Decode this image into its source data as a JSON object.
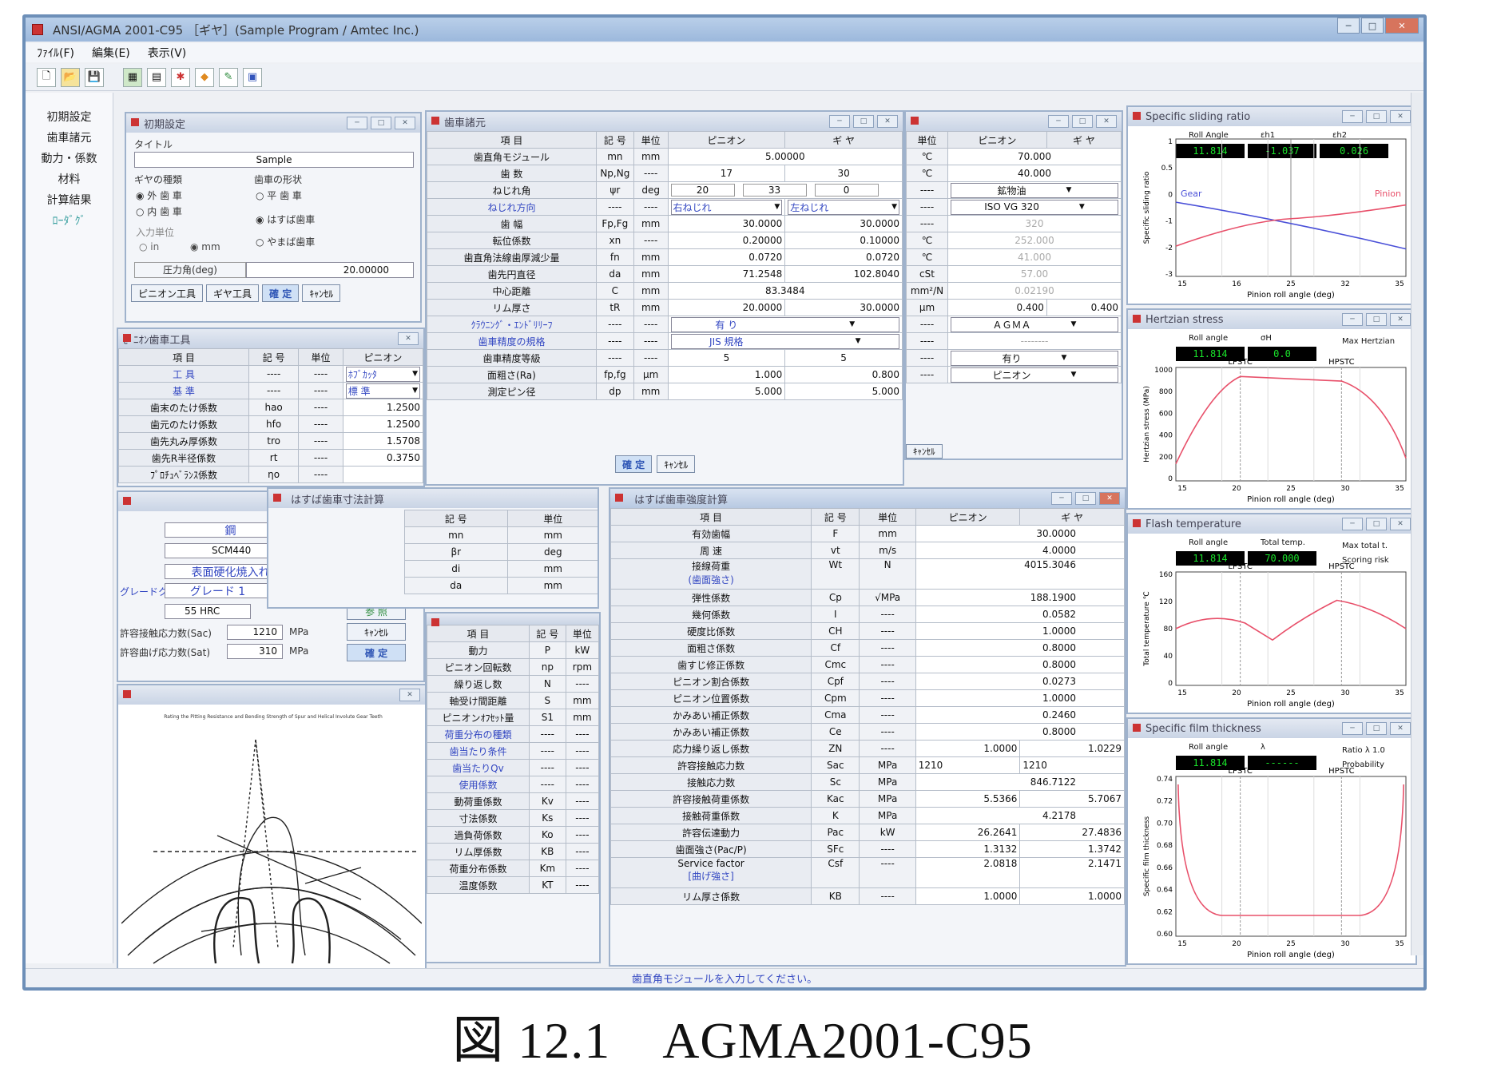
{
  "app": {
    "title": "ANSI/AGMA 2001-C95 ［ギヤ］(Sample Program / Amtec Inc.)",
    "menus": [
      "ﾌｧｲﾙ(F)",
      "編集(E)",
      "表示(V)"
    ],
    "nav": [
      "初期設定",
      "歯車諸元",
      "動力・係数",
      "材料",
      "計算結果",
      "ﾛｰﾀﾞｸﾞ"
    ],
    "status": "歯直角モジュールを入力してください。"
  },
  "initial": {
    "title": "初期設定",
    "title_label": "タイトル",
    "title_value": "Sample",
    "gear_kind_label": "ギヤの種類",
    "gear_kind_options": [
      "外 歯 車",
      "内 歯 車"
    ],
    "tooth_shape_label": "歯車の形状",
    "tooth_shape_options": [
      "平 歯 車",
      "はすば歯車",
      "やまば歯車"
    ],
    "unit_label": "入力単位",
    "unit_options": [
      "in",
      "mm"
    ],
    "pressure_angle_label": "圧力角(deg)",
    "pressure_angle_value": "20.00000",
    "buttons": [
      "ピニオン工具",
      "ギヤ工具",
      "確 定",
      "ｷｬﾝｾﾙ"
    ]
  },
  "cutter": {
    "title": "ﾋﾟﾆｵﾝ歯車工具",
    "headers": [
      "項 目",
      "記 号",
      "単位",
      "ピニオン"
    ],
    "rows": [
      [
        "工 具",
        "----",
        "----",
        "ﾎﾌﾞｶｯﾀ"
      ],
      [
        "基 準",
        "----",
        "----",
        "標 準"
      ],
      [
        "歯末のたけ係数",
        "hao",
        "----",
        "1.2500"
      ],
      [
        "歯元のたけ係数",
        "hfo",
        "----",
        "1.2500"
      ],
      [
        "歯先丸み厚係数",
        "tro",
        "----",
        "1.5708"
      ],
      [
        "歯先R半径係数",
        "rt",
        "----",
        "0.3750"
      ],
      [
        "ﾌﾟﾛﾁｭﾍﾞﾗﾝｽ係数",
        "ηo",
        "----",
        ""
      ]
    ]
  },
  "material": {
    "rows": [
      [
        "",
        "鋼"
      ],
      [
        "",
        "SCM440"
      ],
      [
        "",
        "表面硬化焼入れ"
      ],
      [
        "グレードクラス",
        "グレード 1"
      ],
      [
        "",
        "55 HRC"
      ],
      [
        "許容接触応力数(Sac)",
        "1210",
        "MPa"
      ],
      [
        "許容曲げ応力数(Sat)",
        "310",
        "MPa"
      ]
    ],
    "buttons": [
      "参 照",
      "ｷｬﾝｾﾙ",
      "確 定"
    ]
  },
  "figure": {
    "heading": "Rating the Pitting Resistance and Bending Strength of Spur and Helical Involute Gear Teeth"
  },
  "dims": {
    "title": "はすば歯車寸法計算",
    "headers": [
      "記 号",
      "単位"
    ],
    "rows": [
      [
        "mn",
        "mm"
      ],
      [
        "βr",
        "deg"
      ],
      [
        "di",
        "mm"
      ],
      [
        "da",
        "mm"
      ]
    ]
  },
  "power": {
    "headers": [
      "項 目",
      "記 号",
      "単位"
    ],
    "rows": [
      [
        "動力",
        "P",
        "kW"
      ],
      [
        "ピニオン回転数",
        "np",
        "rpm"
      ],
      [
        "繰り返し数",
        "N",
        "----"
      ],
      [
        "軸受け間距離",
        "S",
        "mm"
      ],
      [
        "ピニオンｵﾌｾｯﾄ量",
        "S1",
        "mm"
      ],
      [
        "荷重分布の種類",
        "----",
        "----"
      ],
      [
        "歯当たり条件",
        "----",
        "----"
      ],
      [
        "歯当たりQv",
        "----",
        "----"
      ],
      [
        "使用係数",
        "----",
        "----"
      ],
      [
        "動荷重係数",
        "Kv",
        "----"
      ],
      [
        "寸法係数",
        "Ks",
        "----"
      ],
      [
        "過負荷係数",
        "Ko",
        "----"
      ],
      [
        "リム厚係数",
        "KB",
        "----"
      ],
      [
        "荷重分布係数",
        "Km",
        "----"
      ],
      [
        "温度係数",
        "KT",
        "----"
      ]
    ]
  },
  "gear_spec": {
    "title": "歯車諸元",
    "headers": [
      "項 目",
      "記 号",
      "単位",
      "ピニオン",
      "ギ ヤ"
    ],
    "rows": [
      {
        "label": "歯直角モジュール",
        "sym": "mn",
        "unit": "mm",
        "p": "5.00000",
        "g": "",
        "merge": true
      },
      {
        "label": "歯 数",
        "sym": "Np,Ng",
        "unit": "----",
        "p": "17",
        "g": "30"
      },
      {
        "label": "ねじれ角",
        "sym": "ψr",
        "unit": "deg",
        "p": "20",
        "g": "",
        "helix": [
          "20",
          "33",
          "0"
        ]
      },
      {
        "label": "ねじれ方向",
        "sym": "----",
        "unit": "----",
        "p": "右ねじれ",
        "g": "左ねじれ",
        "blue": true,
        "dd": true
      },
      {
        "label": "歯 幅",
        "sym": "Fp,Fg",
        "unit": "mm",
        "p": "30.0000",
        "g": "30.0000"
      },
      {
        "label": "転位係数",
        "sym": "xn",
        "unit": "----",
        "p": "0.20000",
        "g": "0.10000"
      },
      {
        "label": "歯直角法線歯厚減少量",
        "sym": "fn",
        "unit": "mm",
        "p": "0.0720",
        "g": "0.0720"
      },
      {
        "label": "歯先円直径",
        "sym": "da",
        "unit": "mm",
        "p": "71.2548",
        "g": "102.8040"
      },
      {
        "label": "中心距離",
        "sym": "C",
        "unit": "mm",
        "p": "83.3484",
        "g": "",
        "merge": true
      },
      {
        "label": "リム厚さ",
        "sym": "tR",
        "unit": "mm",
        "p": "20.0000",
        "g": "30.0000"
      },
      {
        "label": "ｸﾗｳﾆﾝｸﾞ・ｴﾝﾄﾞﾘﾘｰﾌ",
        "sym": "----",
        "unit": "----",
        "p": "有 り",
        "g": "",
        "merge": true,
        "blue": true,
        "dd": true
      },
      {
        "label": "歯車精度の規格",
        "sym": "----",
        "unit": "----",
        "p": "JIS 規格",
        "g": "",
        "merge": true,
        "blue": true,
        "dd": true
      },
      {
        "label": "歯車精度等級",
        "sym": "----",
        "unit": "----",
        "p": "5",
        "g": "5"
      },
      {
        "label": "面粗さ(Ra)",
        "sym": "fp,fg",
        "unit": "μm",
        "p": "1.000",
        "g": "0.800"
      },
      {
        "label": "測定ピン径",
        "sym": "dp",
        "unit": "mm",
        "p": "5.000",
        "g": "5.000"
      }
    ],
    "buttons": [
      "確 定",
      "ｷｬﾝｾﾙ"
    ]
  },
  "operating": {
    "headers": [
      "単位",
      "ピニオン",
      "ギ ヤ"
    ],
    "rows": [
      {
        "unit": "℃",
        "val": "70.000"
      },
      {
        "unit": "℃",
        "val": "40.000"
      },
      {
        "unit": "----",
        "val": "鉱物油",
        "dd": true
      },
      {
        "unit": "----",
        "val": "ISO VG 320",
        "dd": true
      },
      {
        "unit": "----",
        "val": "320",
        "dim": true
      },
      {
        "unit": "℃",
        "val": "252.000",
        "dim": true
      },
      {
        "unit": "℃",
        "val": "41.000",
        "dim": true
      },
      {
        "unit": "cSt",
        "val": "57.00",
        "dim": true
      },
      {
        "unit": "mm²/N",
        "val": "0.02190",
        "dim": true
      },
      {
        "unit": "μm",
        "p": "0.400",
        "g": "0.400"
      },
      {
        "unit": "----",
        "val": "ＡＧＭＡ",
        "dd": true
      },
      {
        "unit": "----",
        "val": "--------",
        "dim": true
      },
      {
        "unit": "----",
        "val": "有り",
        "dd": true
      },
      {
        "unit": "----",
        "val": "ピニオン",
        "dd": true
      }
    ],
    "button": "ｷｬﾝｾﾙ"
  },
  "strength": {
    "title": "はすば歯車強度計算",
    "headers": [
      "項 目",
      "記 号",
      "単位",
      "ピニオン",
      "ギ ヤ"
    ],
    "rows": [
      {
        "label": "有効歯幅",
        "sym": "F",
        "unit": "mm",
        "p": "30.0000",
        "merge": true
      },
      {
        "label": "周 速",
        "sym": "vt",
        "unit": "m/s",
        "p": "4.0000",
        "merge": true
      },
      {
        "label": "接線荷重",
        "sub": "(歯面強さ)",
        "sym": "Wt",
        "unit": "N",
        "p": "4015.3046",
        "merge": true,
        "tall": true
      },
      {
        "label": "弾性係数",
        "sym": "Cp",
        "unit": "√MPa",
        "p": "188.1900",
        "merge": true
      },
      {
        "label": "幾何係数",
        "sym": "I",
        "unit": "----",
        "p": "0.0582",
        "merge": true
      },
      {
        "label": "硬度比係数",
        "sym": "CH",
        "unit": "----",
        "p": "1.0000",
        "merge": true
      },
      {
        "label": "面粗さ係数",
        "sym": "Cf",
        "unit": "----",
        "p": "0.8000",
        "merge": true
      },
      {
        "label": "歯すじ修正係数",
        "sym": "Cmc",
        "unit": "----",
        "p": "0.8000",
        "merge": true
      },
      {
        "label": "ピニオン割合係数",
        "sym": "Cpf",
        "unit": "----",
        "p": "0.0273",
        "merge": true
      },
      {
        "label": "ピニオン位置係数",
        "sym": "Cpm",
        "unit": "----",
        "p": "1.0000",
        "merge": true
      },
      {
        "label": "かみあい補正係数",
        "sym": "Cma",
        "unit": "----",
        "p": "0.2460",
        "merge": true
      },
      {
        "label": "かみあい補正係数",
        "sym": "Ce",
        "unit": "----",
        "p": "0.8000",
        "merge": true
      },
      {
        "label": "応力繰り返し係数",
        "sym": "ZN",
        "unit": "----",
        "p": "1.0000",
        "g": "1.0229"
      },
      {
        "label": "許容接触応力数",
        "sym": "Sac",
        "unit": "MPa",
        "p": "1210",
        "g": "1210"
      },
      {
        "label": "接触応力数",
        "sym": "Sc",
        "unit": "MPa",
        "p": "846.7122",
        "merge": true
      },
      {
        "label": "許容接触荷重係数",
        "sym": "Kac",
        "unit": "MPa",
        "p": "5.5366",
        "g": "5.7067"
      },
      {
        "label": "接触荷重係数",
        "sym": "K",
        "unit": "MPa",
        "p": "4.2178",
        "merge": true
      },
      {
        "label": "許容伝達動力",
        "sym": "Pac",
        "unit": "kW",
        "p": "26.2641",
        "g": "27.4836"
      },
      {
        "label": "歯面強さ(Pac/P)",
        "sym": "SFc",
        "unit": "----",
        "p": "1.3132",
        "g": "1.3742"
      },
      {
        "label": "Service factor",
        "sub": "[曲げ強さ]",
        "sym": "Csf",
        "unit": "----",
        "p": "2.0818",
        "g": "2.1471",
        "tall": true
      },
      {
        "label": "リム厚さ係数",
        "sym": "KB",
        "unit": "----",
        "p": "1.0000",
        "g": "1.0000"
      }
    ]
  },
  "charts": [
    {
      "title": "Specific sliding ratio",
      "readout_labels": [
        "Roll Angle",
        "εh1",
        "εh2"
      ],
      "readout_values": [
        "11.814",
        "-1.037",
        "0.026"
      ],
      "ylabel": "Specific sliding ratio",
      "xlabel": "Pinion roll angle (deg)",
      "legend": [
        "Gear",
        "Pinion"
      ],
      "yticks": [
        "1",
        "0.5",
        "0",
        "-1",
        "-2",
        "-3"
      ],
      "xticks": [
        "15",
        "16",
        "25",
        "32",
        "35"
      ]
    },
    {
      "title": "Hertzian stress",
      "readout_labels": [
        "Roll angle",
        "σH"
      ],
      "readout_values": [
        "11.814",
        "0.0"
      ],
      "side_label": "Max Hertzian",
      "ylabel": "Hertzian stress (MPa)",
      "xlabel": "Pinion roll angle (deg)",
      "markers": [
        "LPSTC",
        "HPSTC"
      ],
      "yticks": [
        "1000",
        "800",
        "600",
        "400",
        "200",
        "0"
      ],
      "xticks": [
        "15",
        "20",
        "25",
        "30",
        "35"
      ]
    },
    {
      "title": "Flash temperature",
      "readout_labels": [
        "Roll angle",
        "Total temp."
      ],
      "readout_values": [
        "11.814",
        "70.000"
      ],
      "side_label": "Max total t.",
      "side_label2": "Scoring risk",
      "ylabel": "Total temperature ℃",
      "xlabel": "Pinion roll angle (deg)",
      "markers": [
        "LPSTC",
        "HPSTC"
      ],
      "yticks": [
        "160",
        "120",
        "80",
        "40",
        "0"
      ],
      "xticks": [
        "15",
        "20",
        "25",
        "30",
        "35"
      ]
    },
    {
      "title": "Specific film thickness",
      "readout_labels": [
        "Roll angle",
        "λ"
      ],
      "readout_values": [
        "11.814",
        "------"
      ],
      "side_label": "Ratio λ  1.0",
      "side_label2": "Probability",
      "ylabel": "Specific film thickness",
      "xlabel": "Pinion roll angle (deg)",
      "markers": [
        "LPSTC",
        "HPSTC"
      ],
      "yticks": [
        "0.74",
        "0.72",
        "0.70",
        "0.68",
        "0.66",
        "0.64",
        "0.62",
        "0.60"
      ],
      "xticks": [
        "15",
        "20",
        "25",
        "30",
        "35"
      ]
    }
  ],
  "caption": "図 12.1　AGMA2001-C95",
  "colors": {
    "accent": "#3347c2",
    "curve": "#e8506a",
    "gear_curve": "#4a50d8",
    "readout_bg": "#000000",
    "readout_fg": "#19e22a"
  }
}
